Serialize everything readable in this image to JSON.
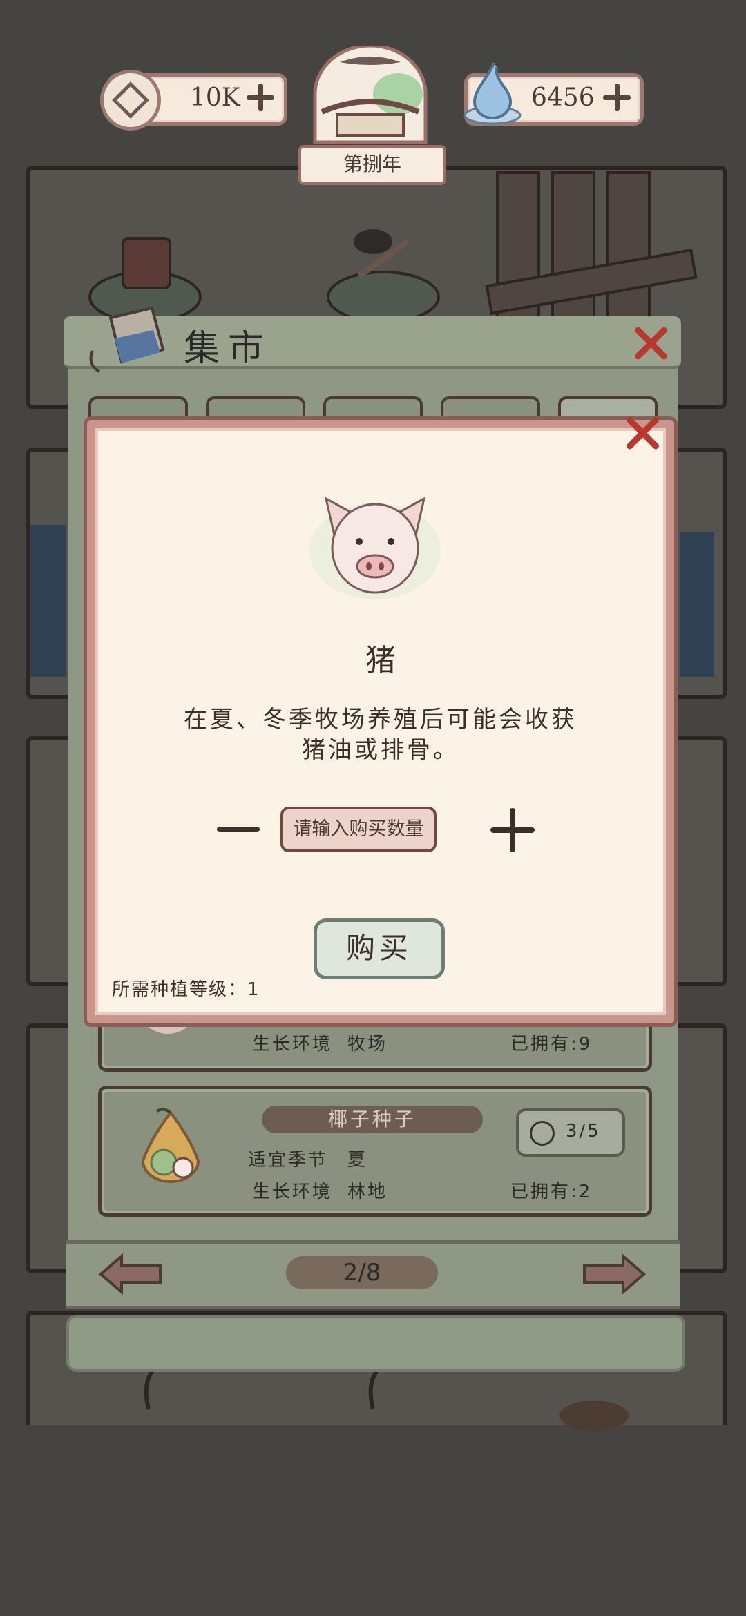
{
  "hud": {
    "coins": "10K",
    "gems": "6456",
    "year": "第捌年"
  },
  "market": {
    "title": "集市",
    "partial_row": {
      "env_label": "生长环境",
      "env_value": "牧场",
      "owned": "已拥有:9"
    },
    "items": [
      {
        "name": "椰子种子",
        "price": "3/5",
        "season_label": "适宜季节",
        "season_value": "夏",
        "env_label": "生长环境",
        "env_value": "林地",
        "owned": "已拥有:2"
      }
    ],
    "page": "2/8"
  },
  "modal": {
    "name": "猪",
    "description_line1": "在夏、冬季牧场养殖后可能会收获",
    "description_line2": "猪油或排骨。",
    "quantity_placeholder": "请输入购买数量",
    "buy_label": "购买",
    "requirement": "所需种植等级：1"
  }
}
